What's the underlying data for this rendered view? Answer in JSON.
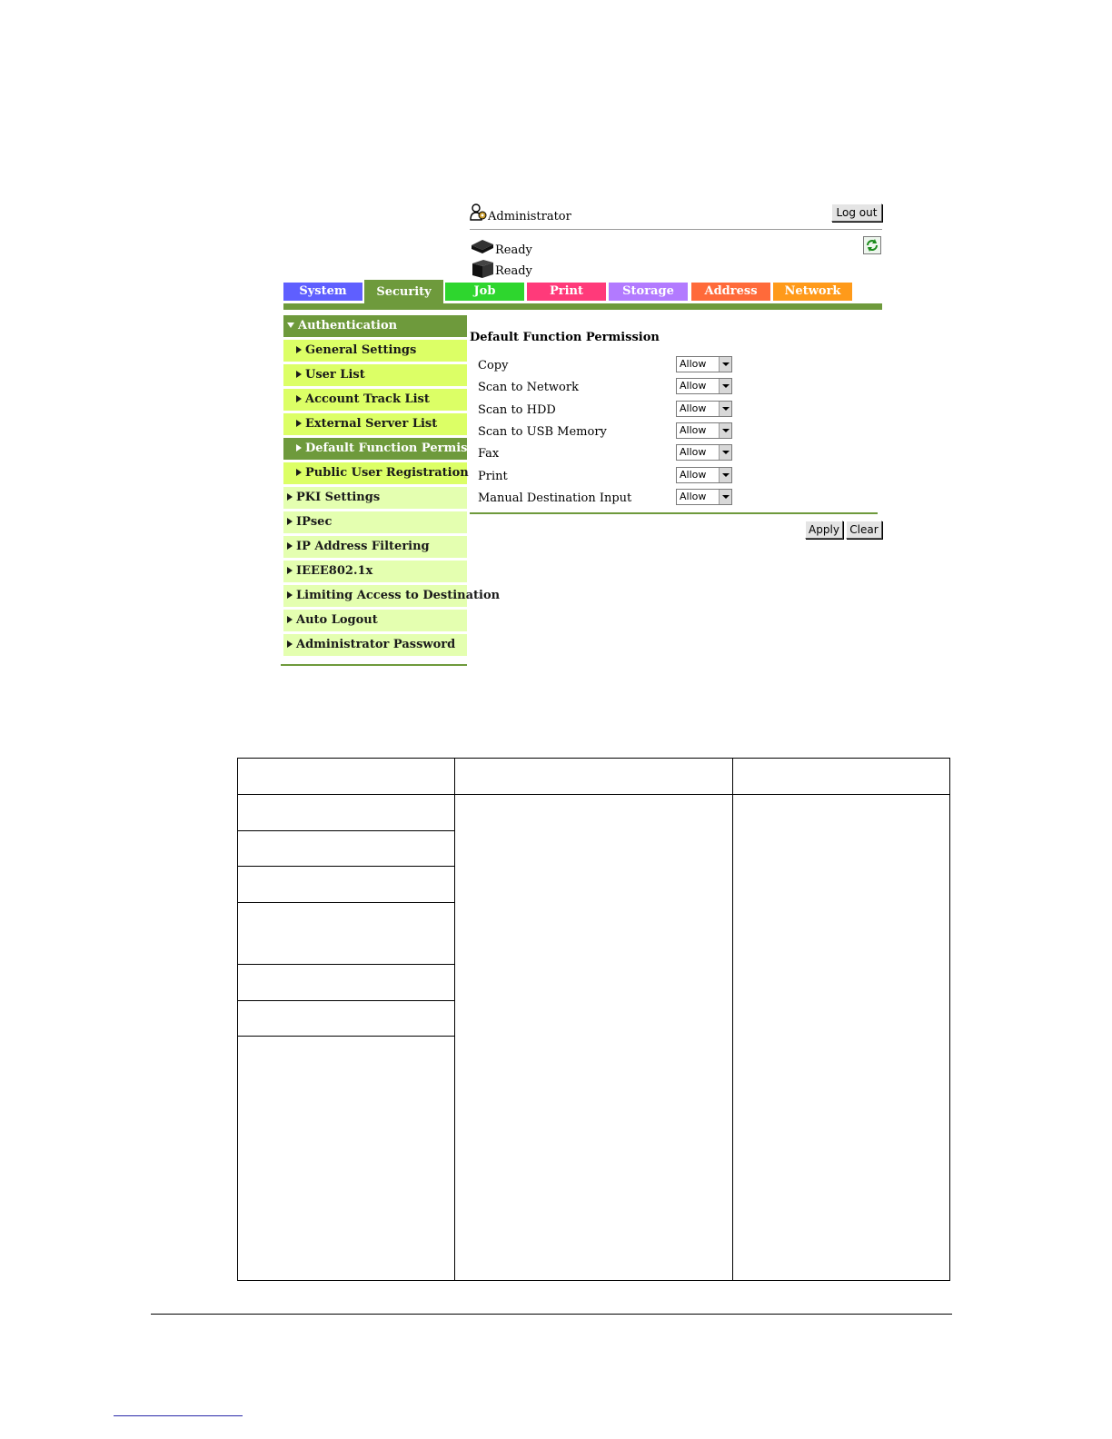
{
  "header": {
    "user_role": "Administrator",
    "logout_label": "Log out",
    "status": [
      "Ready",
      "Ready"
    ]
  },
  "tabs": [
    {
      "label": "System",
      "color": "#5f5fff"
    },
    {
      "label": "Security",
      "color": "#6e9a3c"
    },
    {
      "label": "Job",
      "color": "#2ed62e"
    },
    {
      "label": "Print",
      "color": "#ff3a7a"
    },
    {
      "label": "Storage",
      "color": "#b27aff"
    },
    {
      "label": "Address",
      "color": "#ff6a3a"
    },
    {
      "label": "Network",
      "color": "#ff9a1a"
    }
  ],
  "sidebar": {
    "section": "Authentication",
    "sub_items": [
      "General Settings",
      "User List",
      "Account Track List",
      "External Server List",
      "Default Function Permission",
      "Public User Registration"
    ],
    "items": [
      "PKI Settings",
      "IPsec",
      "IP Address Filtering",
      "IEEE802.1x",
      "Limiting Access to Destination",
      "Auto Logout",
      "Administrator Password"
    ]
  },
  "content": {
    "title": "Default Function Permission",
    "rows": [
      {
        "label": "Copy",
        "value": "Allow"
      },
      {
        "label": "Scan to Network",
        "value": "Allow"
      },
      {
        "label": "Scan to HDD",
        "value": "Allow"
      },
      {
        "label": "Scan to USB Memory",
        "value": "Allow"
      },
      {
        "label": "Fax",
        "value": "Allow"
      },
      {
        "label": "Print",
        "value": "Allow"
      },
      {
        "label": "Manual Destination Input",
        "value": "Allow"
      }
    ],
    "apply_label": "Apply",
    "clear_label": "Clear"
  }
}
